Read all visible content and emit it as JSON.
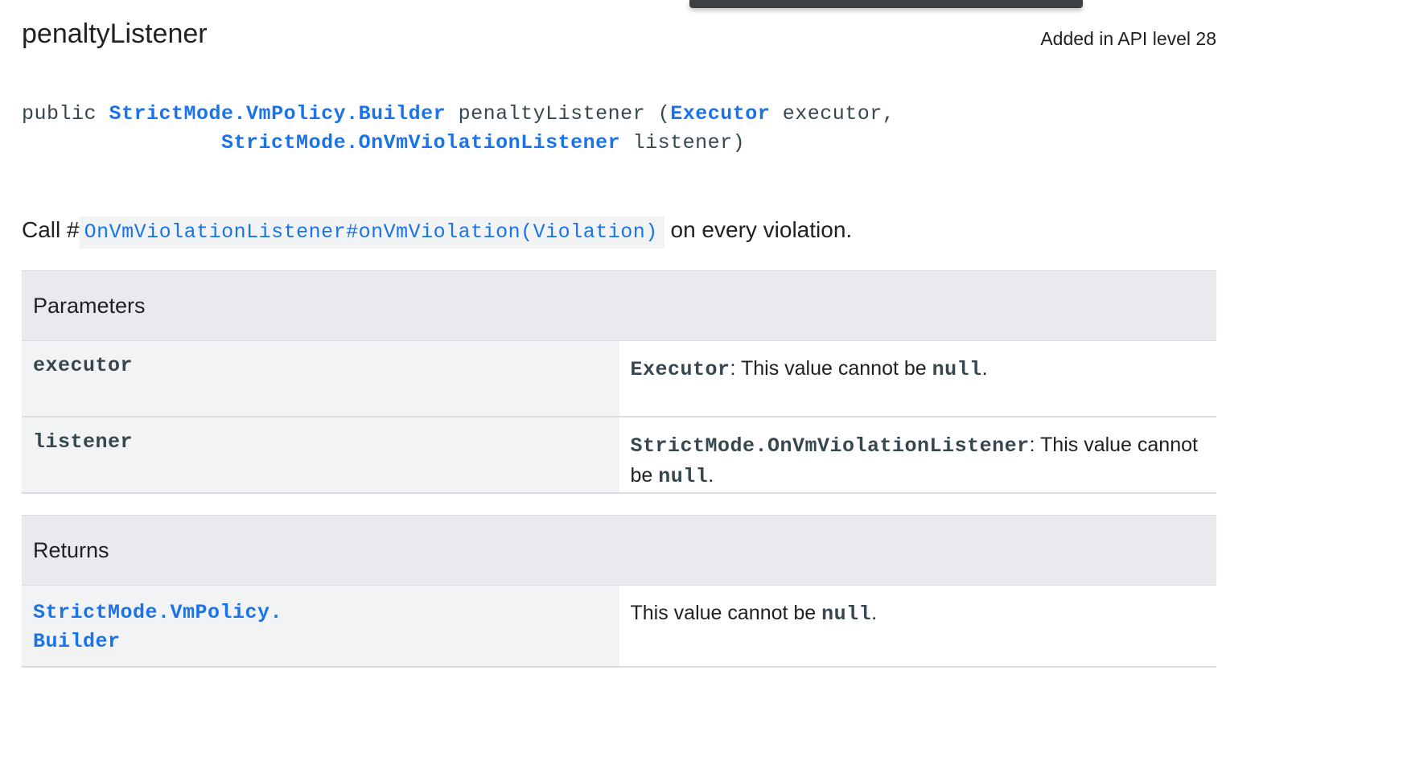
{
  "tooltip_bar_color": "#3c4043",
  "header": {
    "title": "penaltyListener",
    "api_level": "Added in API level 28"
  },
  "signature": {
    "keyword": "public",
    "return_type": "StrictMode.VmPolicy.Builder",
    "method_name": "penaltyListener",
    "open_paren": "(",
    "param1_type": "Executor",
    "param1_name": "executor,",
    "param2_type": "StrictMode.OnVmViolationListener",
    "param2_name": "listener)"
  },
  "description": {
    "prefix": "Call #",
    "link_text": "OnVmViolationListener#onVmViolation(Violation)",
    "suffix": "on every violation."
  },
  "parameters": {
    "heading": "Parameters",
    "rows": [
      {
        "name": "executor",
        "type": "Executor",
        "text": ": This value cannot be ",
        "null": "null",
        "period": "."
      },
      {
        "name": "listener",
        "type": "StrictMode.OnVmViolationListener",
        "text": ": This value cannot be ",
        "null": "null",
        "period": "."
      }
    ]
  },
  "returns": {
    "heading": "Returns",
    "type_line1": "StrictMode.VmPolicy.",
    "type_line2": "Builder",
    "text": "This value cannot be ",
    "null": "null",
    "period": "."
  },
  "colors": {
    "link": "#1a73e8",
    "header_bg": "#e8eaed",
    "name_cell_bg": "#f1f3f4",
    "code_text": "#37474f"
  }
}
